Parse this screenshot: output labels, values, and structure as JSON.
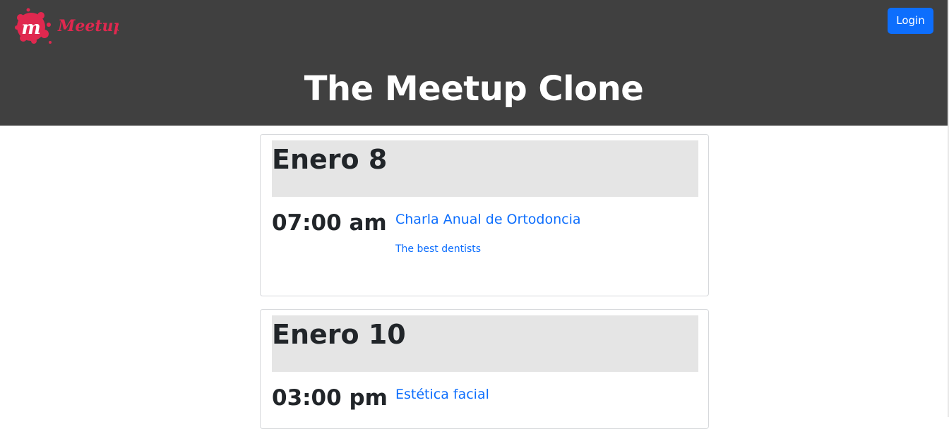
{
  "header": {
    "logo_text": "Meetup",
    "login_label": "Login",
    "title": "The Meetup Clone"
  },
  "colors": {
    "header_bg": "#404040",
    "brand": "#e0284f",
    "primary": "#0d6efd",
    "date_bar": "#e5e5e5"
  },
  "days": [
    {
      "date": "Enero 8",
      "events": [
        {
          "time": "07:00 am",
          "title": "Charla Anual de Ortodoncia",
          "group": "The best dentists"
        }
      ]
    },
    {
      "date": "Enero 10",
      "events": [
        {
          "time": "03:00 pm",
          "title": "Estética facial",
          "group": ""
        }
      ]
    }
  ]
}
